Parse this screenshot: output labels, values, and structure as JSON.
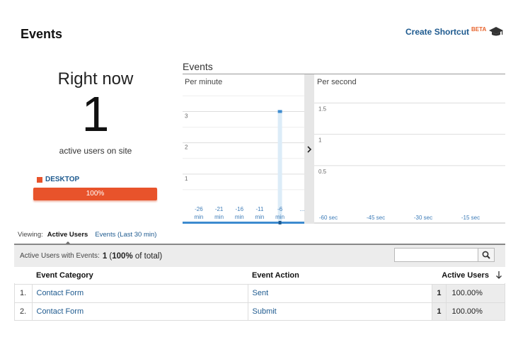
{
  "header": {
    "title": "Events",
    "shortcut_label": "Create Shortcut",
    "beta_label": "BETA",
    "cap_icon": "graduation-cap-icon"
  },
  "right_now": {
    "label": "Right now",
    "count": "1",
    "subtitle": "active users on site",
    "device_label": "DESKTOP",
    "device_percent_label": "100%",
    "device_fraction": 1.0,
    "device_color": "#e8532b"
  },
  "chart": {
    "title": "Events",
    "per_minute_label": "Per minute",
    "per_second_label": "Per second",
    "toggle_icon": "chevron-right-icon"
  },
  "chart_data": [
    {
      "type": "bar",
      "title": "Per minute",
      "x_ticks": [
        "-26",
        "-21",
        "-16",
        "-11",
        "-6",
        "..."
      ],
      "x_unit": "min",
      "y_ticks": [
        "1",
        "2",
        "3"
      ],
      "ylim": [
        0,
        3.6
      ],
      "x_range": [
        -30,
        0
      ],
      "values": [
        {
          "x": -6,
          "y": 3
        }
      ],
      "accent": "#3d8bcf"
    },
    {
      "type": "bar",
      "title": "Per second",
      "x_ticks": [
        "-60 sec",
        "-45 sec",
        "-30 sec",
        "-15 sec"
      ],
      "y_ticks": [
        "0.5",
        "1",
        "1.5"
      ],
      "ylim": [
        0,
        1.8
      ],
      "values": []
    }
  ],
  "viewing": {
    "label": "Viewing:",
    "active_tab": "Active Users",
    "other_tab": "Events (Last 30 min)"
  },
  "summary": {
    "label": "Active Users with Events:",
    "count": "1",
    "percent": "100%",
    "suffix": "of total)",
    "prefix": "(",
    "search_placeholder": "",
    "search_icon": "search-icon"
  },
  "table": {
    "headers": [
      "Event Category",
      "Event Action",
      "Active Users"
    ],
    "sort_icon": "arrow-down-icon",
    "rows": [
      {
        "num": "1.",
        "category": "Contact Form",
        "action": "Sent",
        "users": "1",
        "percent": "100.00%"
      },
      {
        "num": "2.",
        "category": "Contact Form",
        "action": "Submit",
        "users": "1",
        "percent": "100.00%"
      }
    ]
  }
}
